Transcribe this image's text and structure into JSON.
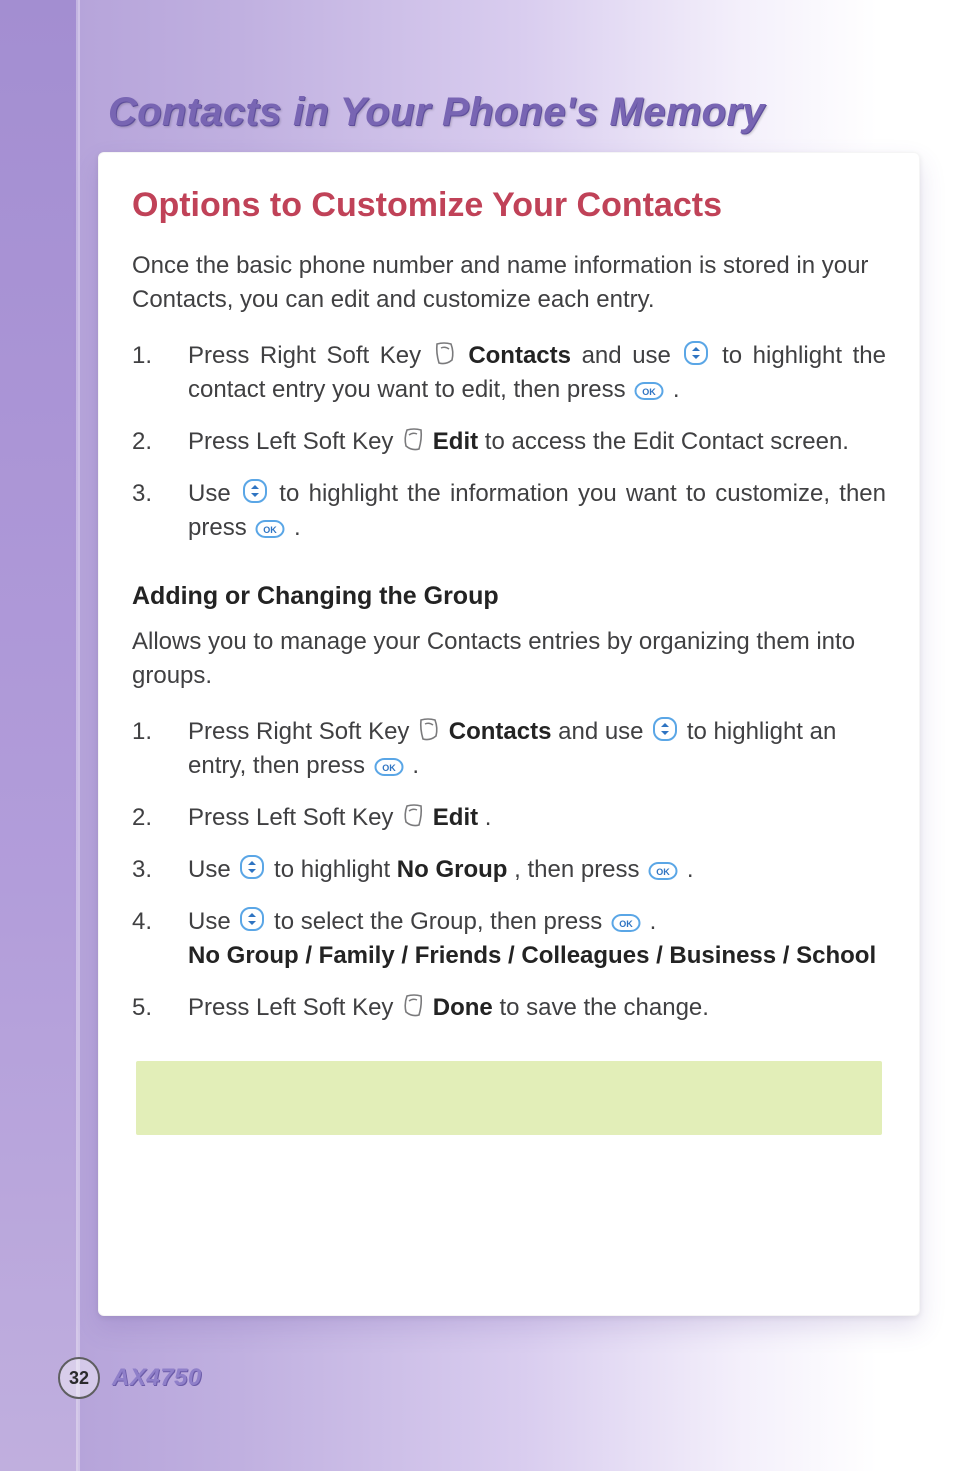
{
  "page": {
    "title": "Contacts in Your Phone's Memory",
    "number": "32",
    "model": "AX4750"
  },
  "section1": {
    "heading": "Options to Customize Your Contacts",
    "intro": "Once the basic phone number and name information is stored in your Contacts, you can edit and customize each entry.",
    "s1_1a": "Press Right Soft Key ",
    "s1_1b": " Contacts",
    "s1_1c": " and use ",
    "s1_1d": " to highlight the contact entry you want to edit, then press ",
    "s1_1e": ".",
    "s1_2a": "Press Left Soft Key ",
    "s1_2b": " Edit",
    "s1_2c": " to access the Edit Contact screen.",
    "s1_3a": "Use ",
    "s1_3b": " to highlight the information you want to customize, then press ",
    "s1_3c": "."
  },
  "section2": {
    "heading": "Adding or Changing the Group",
    "intro": "Allows you to manage your Contacts entries by organizing them into groups.",
    "s2_1a": "Press Right Soft Key ",
    "s2_1b": " Contacts",
    "s2_1c": " and use ",
    "s2_1d": " to highlight an entry, then press ",
    "s2_1e": ".",
    "s2_2a": "Press Left Soft Key ",
    "s2_2b": " Edit",
    "s2_2c": ".",
    "s2_3a": "Use ",
    "s2_3b": " to highlight ",
    "s2_3c": "No Group",
    "s2_3d": ", then press ",
    "s2_3e": ".",
    "s2_4a": "Use ",
    "s2_4b": " to select the Group, then press ",
    "s2_4c": ".",
    "s2_4d": "No Group / Family / Friends / Colleagues / Business / School",
    "s2_5a": "Press Left Soft Key ",
    "s2_5b": " Done",
    "s2_5c": " to save the change."
  },
  "icons": {
    "right_soft_key": "right-soft-key-icon",
    "left_soft_key": "left-soft-key-icon",
    "nav_updown": "nav-updown-icon",
    "ok_key": "ok-key-icon"
  }
}
